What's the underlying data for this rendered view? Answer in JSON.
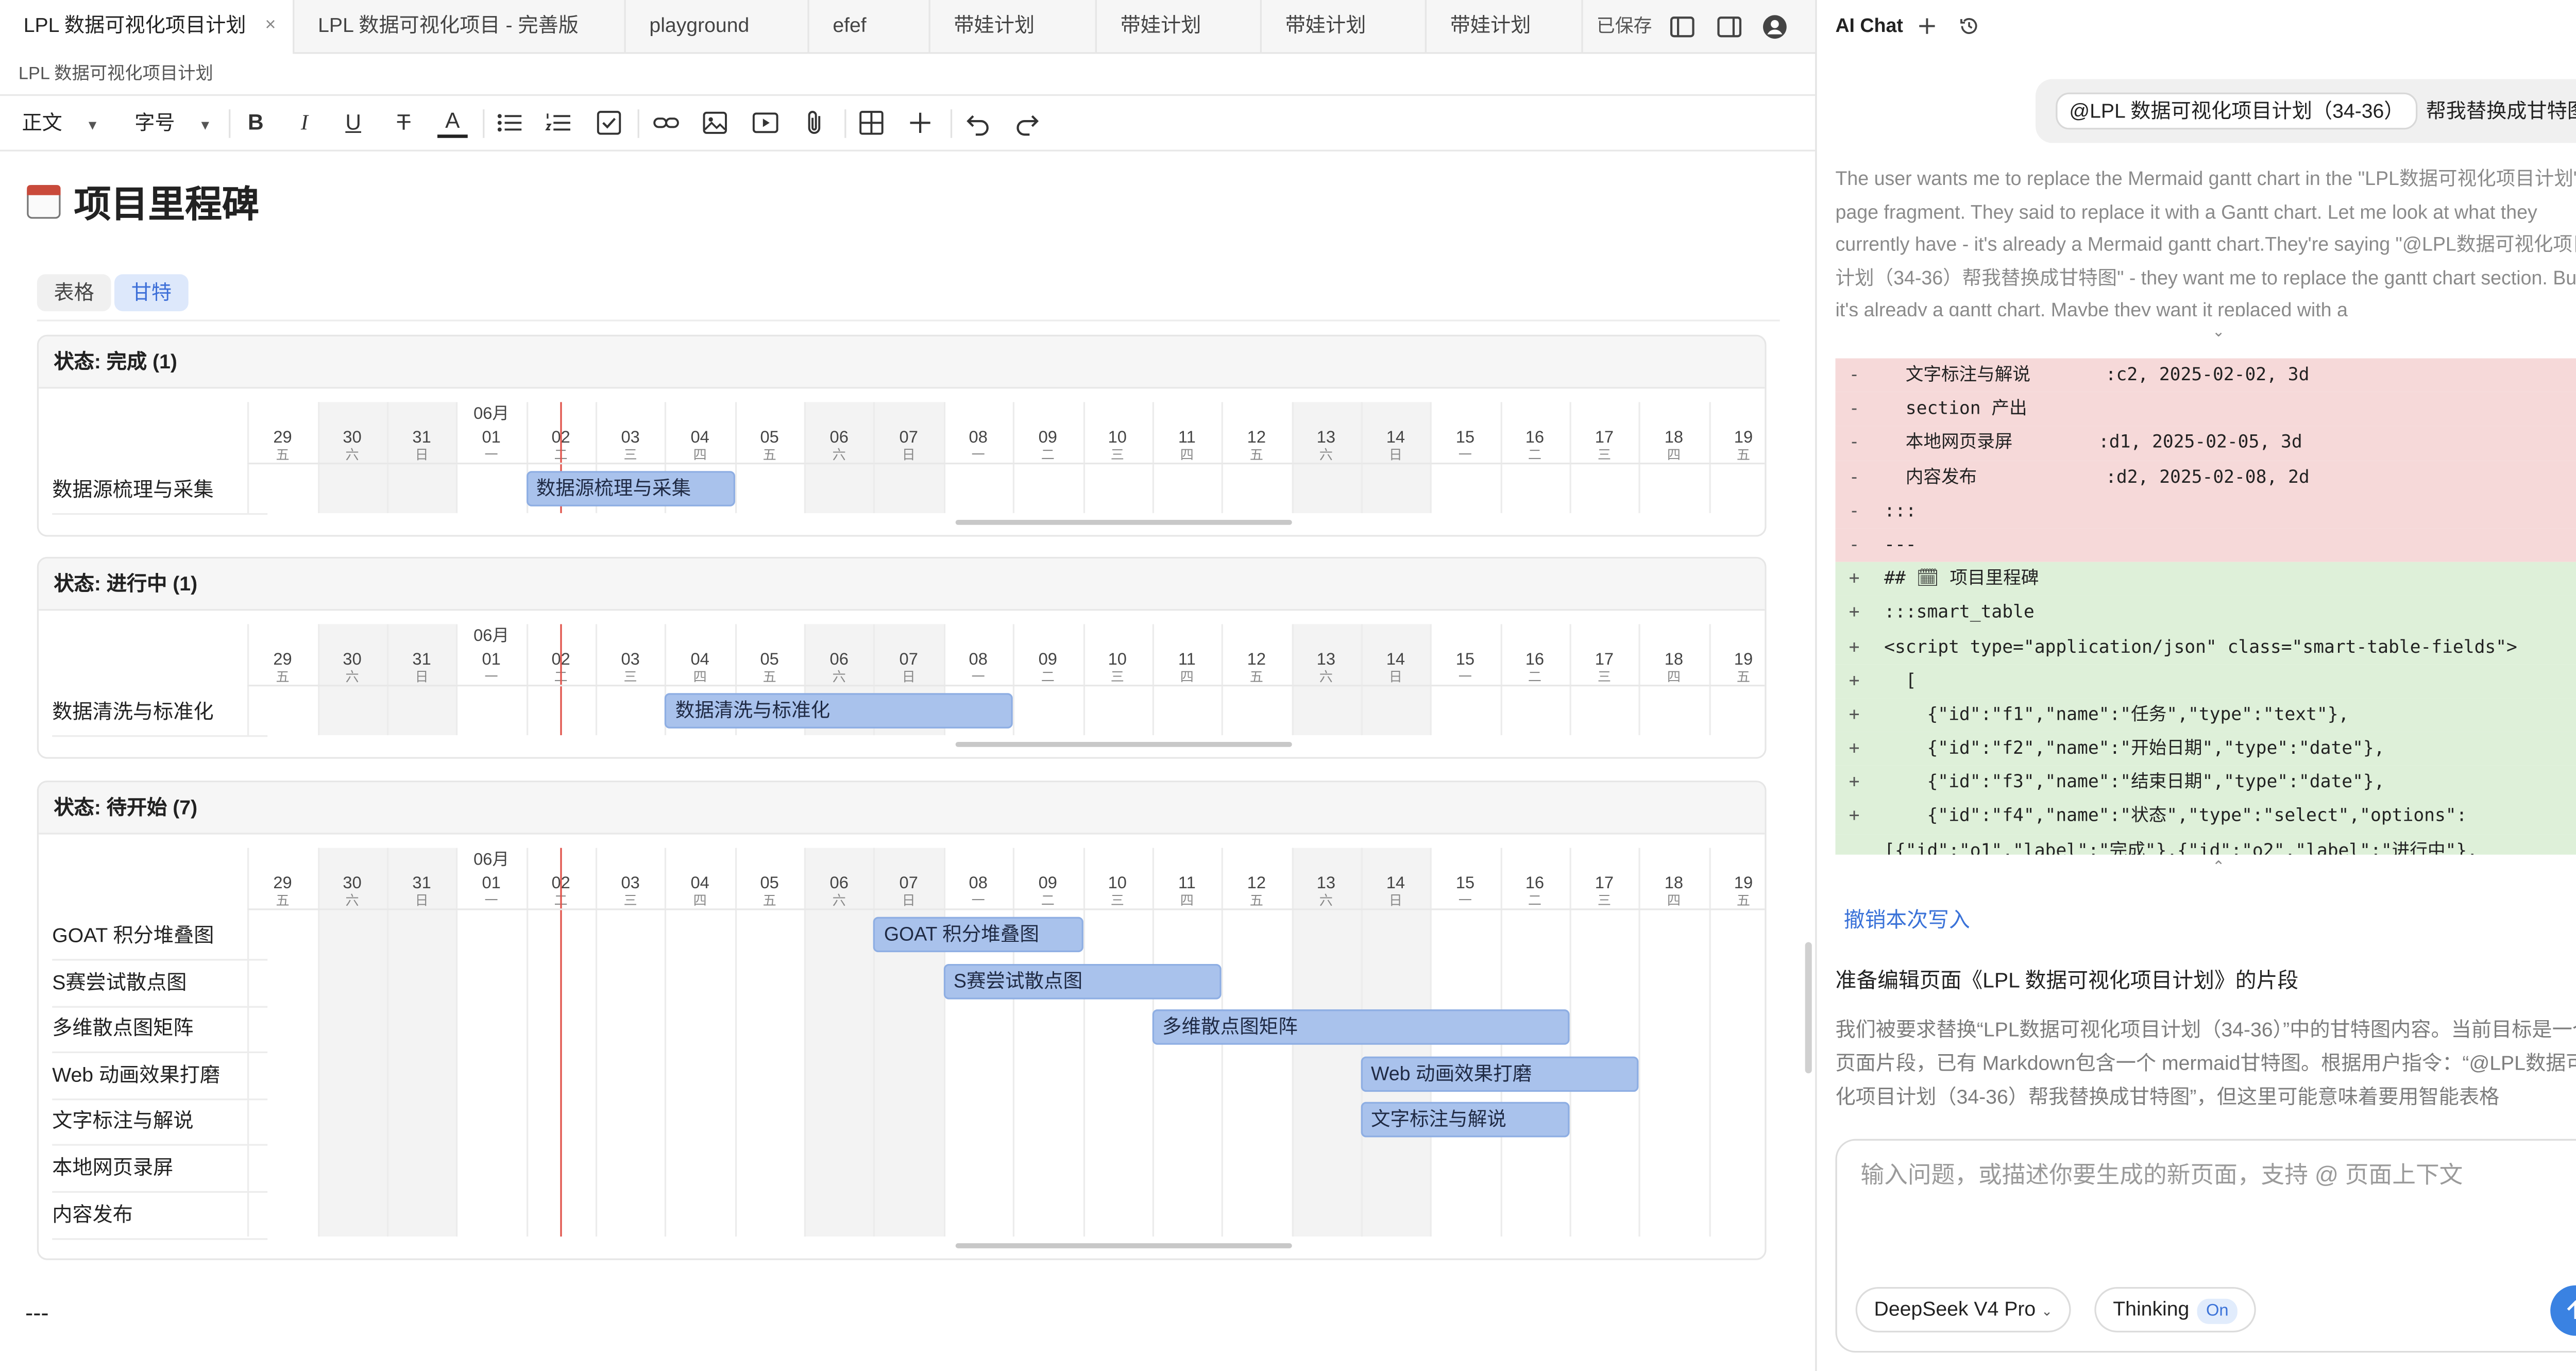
{
  "tabs": [
    {
      "label": "LPL 数据可视化项目计划",
      "close": "×"
    },
    {
      "label": "LPL 数据可视化项目 - 完善版"
    },
    {
      "label": "playground"
    },
    {
      "label": "efef"
    },
    {
      "label": "带娃计划"
    },
    {
      "label": "带娃计划"
    },
    {
      "label": "带娃计划"
    },
    {
      "label": "带娃计划"
    }
  ],
  "saved_label": "已保存",
  "toolbar_icons": [
    "sidebar-left-icon",
    "sidebar-right-icon",
    "user-avatar-icon"
  ],
  "breadcrumb": "LPL 数据可视化项目计划",
  "format_toolbar": {
    "paragraph_style": "正文",
    "font_size": "字号",
    "buttons": [
      "bold-icon",
      "italic-icon",
      "underline-icon",
      "strikethrough-icon",
      "text-color-icon",
      "bullet-list-icon",
      "numbered-list-icon",
      "checklist-icon",
      "link-icon",
      "image-icon",
      "video-icon",
      "attachment-icon",
      "table-icon",
      "insert-plus-icon",
      "undo-icon",
      "redo-icon"
    ]
  },
  "heading": "项目里程碑",
  "view_tabs": {
    "table": "表格",
    "gantt": "甘特"
  },
  "gantt": {
    "month_label": "06月",
    "days": [
      {
        "d": "29",
        "w": "五",
        "weekend": false
      },
      {
        "d": "30",
        "w": "六",
        "weekend": true
      },
      {
        "d": "31",
        "w": "日",
        "weekend": true
      },
      {
        "d": "01",
        "w": "一",
        "weekend": false
      },
      {
        "d": "02",
        "w": "二",
        "weekend": false,
        "today": true
      },
      {
        "d": "03",
        "w": "三",
        "weekend": false
      },
      {
        "d": "04",
        "w": "四",
        "weekend": false
      },
      {
        "d": "05",
        "w": "五",
        "weekend": false
      },
      {
        "d": "06",
        "w": "六",
        "weekend": true
      },
      {
        "d": "07",
        "w": "日",
        "weekend": true
      },
      {
        "d": "08",
        "w": "一",
        "weekend": false
      },
      {
        "d": "09",
        "w": "二",
        "weekend": false
      },
      {
        "d": "10",
        "w": "三",
        "weekend": false
      },
      {
        "d": "11",
        "w": "四",
        "weekend": false
      },
      {
        "d": "12",
        "w": "五",
        "weekend": false
      },
      {
        "d": "13",
        "w": "六",
        "weekend": true
      },
      {
        "d": "14",
        "w": "日",
        "weekend": true
      },
      {
        "d": "15",
        "w": "一",
        "weekend": false
      },
      {
        "d": "16",
        "w": "二",
        "weekend": false
      },
      {
        "d": "17",
        "w": "三",
        "weekend": false
      },
      {
        "d": "18",
        "w": "四",
        "weekend": false
      },
      {
        "d": "19",
        "w": "五",
        "weekend": false
      }
    ],
    "groups": [
      {
        "title": "状态: 完成 (1)",
        "tasks": [
          {
            "name": "数据源梳理与采集",
            "start": "06-02",
            "days": 3
          }
        ]
      },
      {
        "title": "状态: 进行中 (1)",
        "tasks": [
          {
            "name": "数据清洗与标准化",
            "start": "06-04",
            "days": 5
          }
        ]
      },
      {
        "title": "状态: 待开始 (7)",
        "tasks": [
          {
            "name": "GOAT 积分堆叠图",
            "start": "06-07",
            "days": 3
          },
          {
            "name": "S赛尝试散点图",
            "start": "06-08",
            "days": 4
          },
          {
            "name": "多维散点图矩阵",
            "start": "06-11",
            "days": 6
          },
          {
            "name": "Web 动画效果打磨",
            "start": "06-14",
            "days": 4
          },
          {
            "name": "文字标注与解说",
            "start": "06-14",
            "days": 3
          },
          {
            "name": "本地网页录屏"
          },
          {
            "name": "内容发布"
          }
        ]
      }
    ]
  },
  "trailing_text": "---",
  "ai_chat": {
    "title": "AI Chat",
    "header_icons": [
      "new-chat-plus-icon",
      "history-icon"
    ],
    "user_message": {
      "mention": "@LPL 数据可视化项目计划（34-36）",
      "text": "帮我替换成甘特图"
    },
    "thinking_text": "The user wants me to replace the Mermaid gantt chart in the \"LPL数据可视化项目计划\" page fragment. They said to replace it with a Gantt chart. Let me look at what they currently have - it's already a Mermaid gantt chart.They're saying \"@LPL数据可视化项目计划（34-36）帮我替换成甘特图\" - they want me to replace the gantt chart section. But it's already a gantt chart. Maybe they want it replaced with a",
    "diff_lines": [
      {
        "sign": "-",
        "type": "m",
        "text": "  文字标注与解说       :c2, 2025-02-02, 3d"
      },
      {
        "sign": "-",
        "type": "m",
        "text": "  section 产出"
      },
      {
        "sign": "-",
        "type": "m",
        "text": "  本地网页录屏        :d1, 2025-02-05, 3d"
      },
      {
        "sign": "-",
        "type": "m",
        "text": "  内容发布            :d2, 2025-02-08, 2d"
      },
      {
        "sign": "-",
        "type": "m",
        "text": ":::"
      },
      {
        "sign": "-",
        "type": "m",
        "text": "---"
      },
      {
        "sign": "+",
        "type": "p",
        "text": "## 🗓 项目里程碑"
      },
      {
        "sign": "+",
        "type": "p",
        "text": ":::smart_table"
      },
      {
        "sign": "+",
        "type": "p",
        "text": "<script type=\"application/json\" class=\"smart-table-fields\">"
      },
      {
        "sign": "+",
        "type": "p",
        "text": "  ["
      },
      {
        "sign": "+",
        "type": "p",
        "text": "    {\"id\":\"f1\",\"name\":\"任务\",\"type\":\"text\"},"
      },
      {
        "sign": "+",
        "type": "p",
        "text": "    {\"id\":\"f2\",\"name\":\"开始日期\",\"type\":\"date\"},"
      },
      {
        "sign": "+",
        "type": "p",
        "text": "    {\"id\":\"f3\",\"name\":\"结束日期\",\"type\":\"date\"},"
      },
      {
        "sign": "+",
        "type": "p",
        "text": "    {\"id\":\"f4\",\"name\":\"状态\",\"type\":\"select\",\"options\":"
      },
      {
        "sign": "",
        "type": "p",
        "text": "[{\"id\":\"o1\",\"label\":\"完成\"},{\"id\":\"o2\",\"label\":\"进行中\"},"
      }
    ],
    "undo_write": "撤销本次写入",
    "section_heading": "准备编辑页面《LPL 数据可视化项目计划》的片段",
    "paragraph": "我们被要求替换“LPL数据可视化项目计划（34-36）”中的甘特图内容。当前目标是一个页面片段，已有 Markdown包含一个 mermaid甘特图。根据用户指令：“@LPL数据可视化项目计划（34-36）帮我替换成甘特图”，但这里可能意味着要用智能表格（smart_table）形式的甘特图来替换原有的 mermaid甘特图。因为用户提出了替换成",
    "input_placeholder": "输入问题，或描述你要生成的新页面，支持 @ 页面上下文",
    "model": "DeepSeek V4 Pro",
    "thinking_label": "Thinking",
    "thinking_state": "On"
  },
  "colors": {
    "accent": "#3a82e2",
    "bar": "#a9c2ec",
    "bar_border": "#8eaee3",
    "today_line": "#e0524a",
    "diff_removed": "#f6d9d9",
    "diff_added": "#def0d9",
    "weekend": "#f3f3f3"
  }
}
